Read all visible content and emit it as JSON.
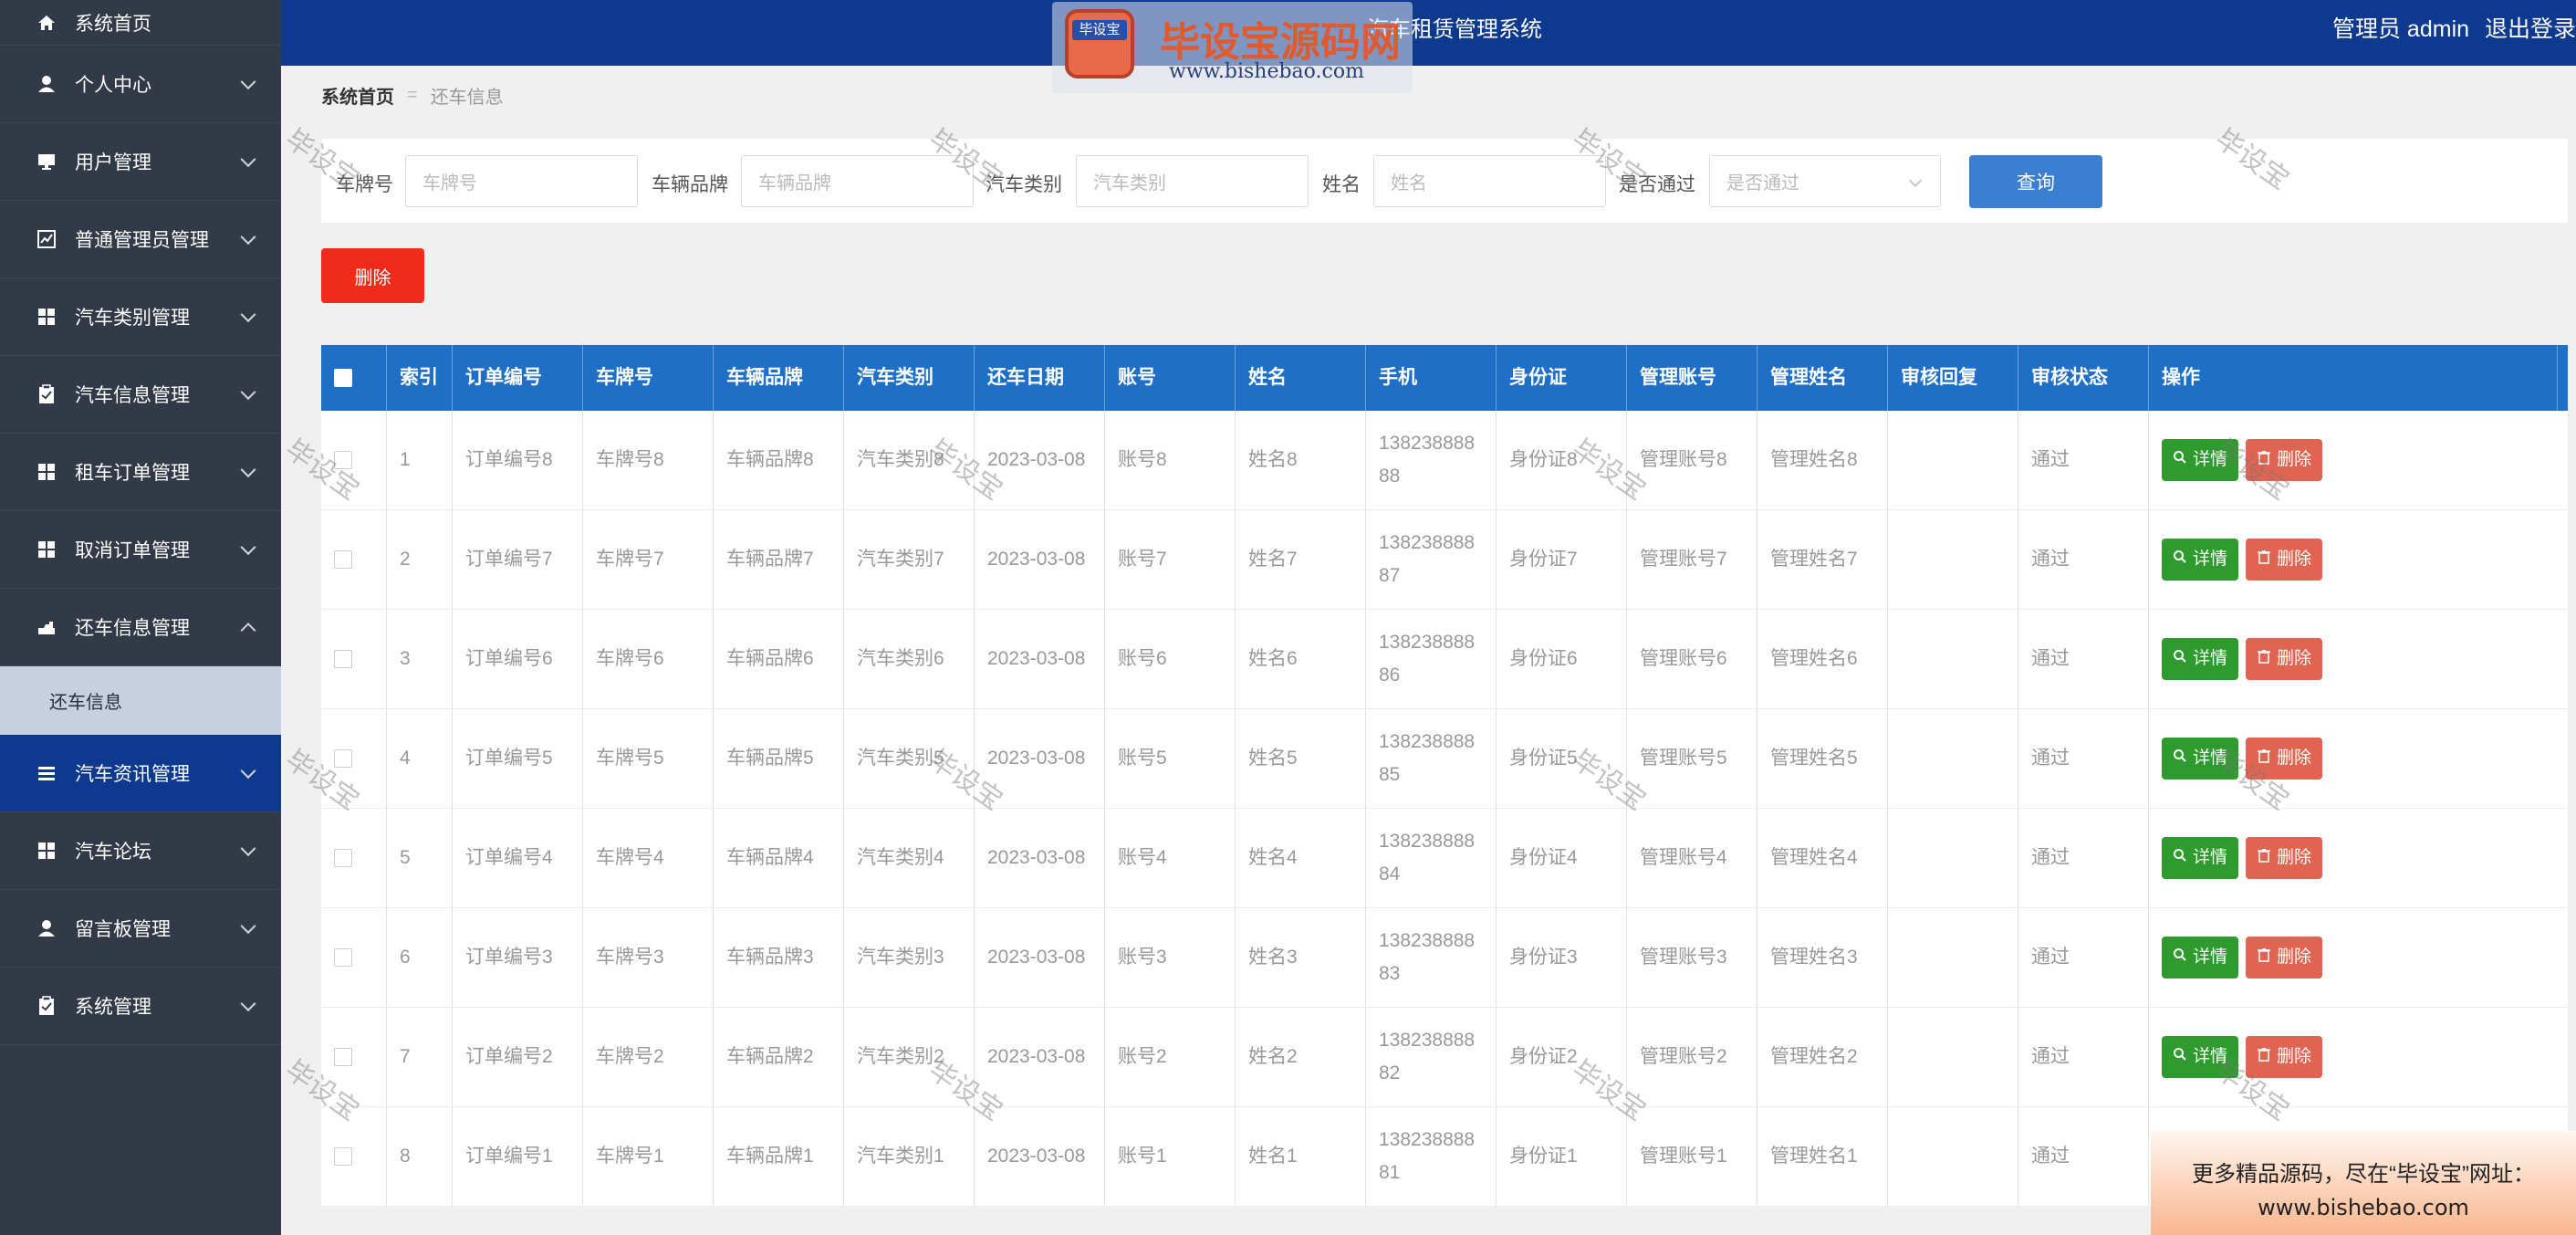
{
  "header": {
    "title": "汽车租赁管理系统",
    "user": "管理员 admin",
    "logout": "退出登录"
  },
  "logo_watermark": {
    "badge": "毕设宝",
    "big": "毕设宝源码网",
    "url": "www.bishebao.com"
  },
  "breadcrumb": {
    "home": "系统首页",
    "separator": "=",
    "current": "还车信息"
  },
  "sidebar": {
    "items": [
      {
        "label": "系统首页",
        "icon": "home-icon"
      },
      {
        "label": "个人中心",
        "icon": "user-icon"
      },
      {
        "label": "用户管理",
        "icon": "monitor-icon"
      },
      {
        "label": "普通管理员管理",
        "icon": "chart-icon"
      },
      {
        "label": "汽车类别管理",
        "icon": "grid-icon"
      },
      {
        "label": "汽车信息管理",
        "icon": "clipboard-icon"
      },
      {
        "label": "租车订单管理",
        "icon": "grid-icon"
      },
      {
        "label": "取消订单管理",
        "icon": "grid-icon"
      },
      {
        "label": "还车信息管理",
        "icon": "hand-icon"
      },
      {
        "label": "汽车资讯管理",
        "icon": "list-icon"
      },
      {
        "label": "汽车论坛",
        "icon": "grid-icon"
      },
      {
        "label": "留言板管理",
        "icon": "user-icon"
      },
      {
        "label": "系统管理",
        "icon": "clipboard-icon"
      }
    ],
    "sub_item": "还车信息"
  },
  "search": {
    "plate_label": "车牌号",
    "plate_placeholder": "车牌号",
    "brand_label": "车辆品牌",
    "brand_placeholder": "车辆品牌",
    "type_label": "汽车类别",
    "type_placeholder": "汽车类别",
    "name_label": "姓名",
    "name_placeholder": "姓名",
    "pass_label": "是否通过",
    "pass_placeholder": "是否通过",
    "query_button": "查询"
  },
  "delete_button": "删除",
  "table": {
    "headers": [
      "索引",
      "订单编号",
      "车牌号",
      "车辆品牌",
      "汽车类别",
      "还车日期",
      "账号",
      "姓名",
      "手机",
      "身份证",
      "管理账号",
      "管理姓名",
      "审核回复",
      "审核状态",
      "操作"
    ],
    "rows": [
      [
        "1",
        "订单编号8",
        "车牌号8",
        "车辆品牌8",
        "汽车类别8",
        "2023-03-08",
        "账号8",
        "姓名8",
        "13823888888",
        "身份证8",
        "管理账号8",
        "管理姓名8",
        "",
        "通过"
      ],
      [
        "2",
        "订单编号7",
        "车牌号7",
        "车辆品牌7",
        "汽车类别7",
        "2023-03-08",
        "账号7",
        "姓名7",
        "13823888887",
        "身份证7",
        "管理账号7",
        "管理姓名7",
        "",
        "通过"
      ],
      [
        "3",
        "订单编号6",
        "车牌号6",
        "车辆品牌6",
        "汽车类别6",
        "2023-03-08",
        "账号6",
        "姓名6",
        "13823888886",
        "身份证6",
        "管理账号6",
        "管理姓名6",
        "",
        "通过"
      ],
      [
        "4",
        "订单编号5",
        "车牌号5",
        "车辆品牌5",
        "汽车类别5",
        "2023-03-08",
        "账号5",
        "姓名5",
        "13823888885",
        "身份证5",
        "管理账号5",
        "管理姓名5",
        "",
        "通过"
      ],
      [
        "5",
        "订单编号4",
        "车牌号4",
        "车辆品牌4",
        "汽车类别4",
        "2023-03-08",
        "账号4",
        "姓名4",
        "13823888884",
        "身份证4",
        "管理账号4",
        "管理姓名4",
        "",
        "通过"
      ],
      [
        "6",
        "订单编号3",
        "车牌号3",
        "车辆品牌3",
        "汽车类别3",
        "2023-03-08",
        "账号3",
        "姓名3",
        "13823888883",
        "身份证3",
        "管理账号3",
        "管理姓名3",
        "",
        "通过"
      ],
      [
        "7",
        "订单编号2",
        "车牌号2",
        "车辆品牌2",
        "汽车类别2",
        "2023-03-08",
        "账号2",
        "姓名2",
        "13823888882",
        "身份证2",
        "管理账号2",
        "管理姓名2",
        "",
        "通过"
      ],
      [
        "8",
        "订单编号1",
        "车牌号1",
        "车辆品牌1",
        "汽车类别1",
        "2023-03-08",
        "账号1",
        "姓名1",
        "13823888881",
        "身份证1",
        "管理账号1",
        "管理姓名1",
        "",
        "通过"
      ]
    ],
    "detail_label": "详情",
    "delete_label": "删除"
  },
  "watermark_text": "毕设宝",
  "ad": {
    "line1": "更多精品源码，尽在“毕设宝”网址：",
    "line2": "www.bishebao.com"
  },
  "colors": {
    "header": "#0d3a8f",
    "sidebar": "#323a47",
    "table_header": "#1f6fc7",
    "query": "#3a7fd0",
    "delete": "#f02b1a",
    "detail": "#2f9b2f"
  }
}
